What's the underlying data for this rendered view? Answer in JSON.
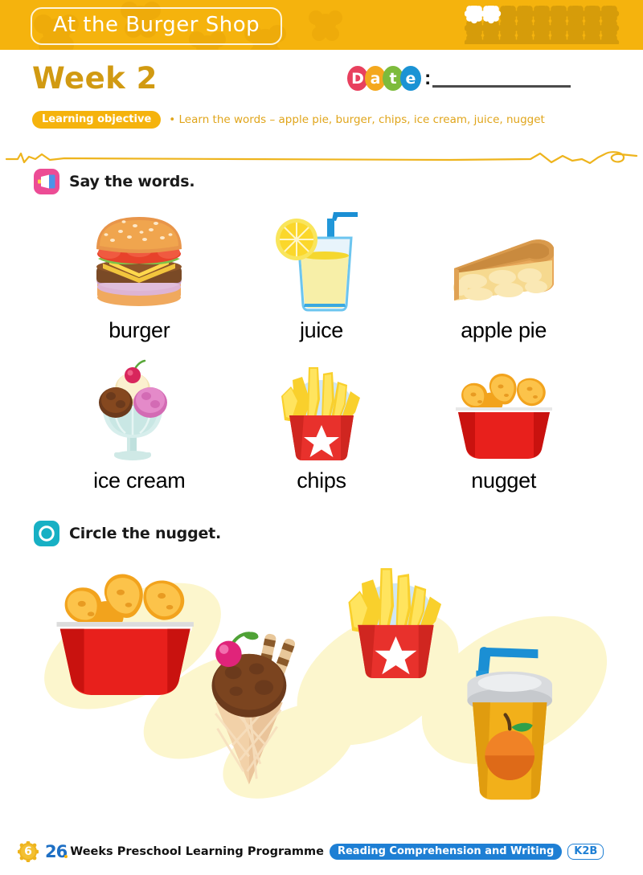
{
  "header": {
    "title": "At the Burger Shop",
    "bg_color": "#f5b30d",
    "dots": {
      "total_rows": 3,
      "per_row": 9,
      "filled_count": 2,
      "filled_color": "#ffffff",
      "dot_color": "#d69c0a"
    }
  },
  "week": {
    "label": "Week 2",
    "color": "#d19a12"
  },
  "date": {
    "letters": [
      {
        "char": "D",
        "color": "#e8405e"
      },
      {
        "char": "a",
        "color": "#f4a81e"
      },
      {
        "char": "t",
        "color": "#7dbb3c"
      },
      {
        "char": "e",
        "color": "#1b93d4"
      }
    ],
    "colon": ":",
    "value": ""
  },
  "learning_objective": {
    "badge": "Learning objective",
    "text": "• Learn the words – apple pie, burger, chips, ice cream, juice, nugget",
    "badge_bg": "#f5b30d",
    "text_color": "#e0a51b"
  },
  "tasks": [
    {
      "id": "say-the-words",
      "icon": "megaphone-icon",
      "icon_color": "#ec4c95",
      "label": "Say the words."
    },
    {
      "id": "circle-the-nugget",
      "icon": "circle-outline-icon",
      "icon_color": "#17b0c4",
      "label": "Circle the nugget."
    }
  ],
  "words": [
    {
      "id": "burger",
      "label": "burger",
      "art": "burger-illustration"
    },
    {
      "id": "juice",
      "label": "juice",
      "art": "juice-glass-illustration"
    },
    {
      "id": "apple-pie",
      "label": "apple pie",
      "art": "apple-pie-illustration"
    },
    {
      "id": "ice-cream",
      "label": "ice cream",
      "art": "ice-cream-sundae-illustration"
    },
    {
      "id": "chips",
      "label": "chips",
      "art": "fries-carton-illustration"
    },
    {
      "id": "nugget",
      "label": "nugget",
      "art": "nugget-bucket-illustration"
    }
  ],
  "circle_activity": {
    "answer": "nugget",
    "items": [
      {
        "id": "nugget-bucket",
        "name": "nugget-bucket-illustration",
        "is_answer": true
      },
      {
        "id": "ice-cream-cone",
        "name": "ice-cream-cone-illustration",
        "is_answer": false
      },
      {
        "id": "fries-carton",
        "name": "fries-carton-illustration",
        "is_answer": false
      },
      {
        "id": "juice-cup",
        "name": "orange-juice-cup-illustration",
        "is_answer": false
      }
    ],
    "blob_color": "#fcf6cd"
  },
  "footer": {
    "page_number": "6",
    "number": "26",
    "programme": "Weeks Preschool Learning Programme",
    "subject": "Reading Comprehension and Writing",
    "level": "K2B",
    "accent": "#1e7fd4"
  }
}
